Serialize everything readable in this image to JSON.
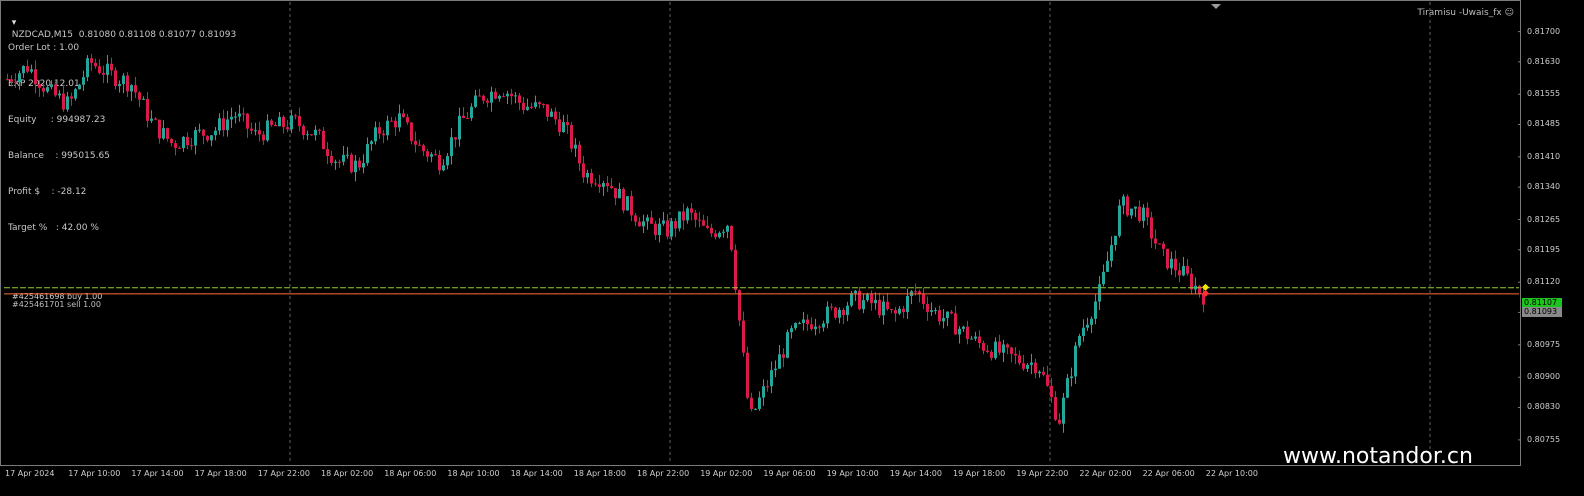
{
  "header": {
    "symbol_line": "NZDCAD,M15  0.81080 0.81108 0.81077 0.81093",
    "ea_name": "Tiramisu -Uwais_fx"
  },
  "info": [
    "Order Lot : 1.00",
    "EXP 2020.12.01",
    "Equity     : 994987.23",
    "Balance    : 995015.65",
    "Profit $    : -28.12",
    "Target %   : 42.00 %"
  ],
  "orders": {
    "buy_label": "#425461698 buy 1.00",
    "sell_label": "#425461701 sell 1.00"
  },
  "price_axis": [
    "0.81700",
    "0.81630",
    "0.81555",
    "0.81485",
    "0.81410",
    "0.81340",
    "0.81265",
    "0.81195",
    "0.81120",
    "0.81050",
    "0.80975",
    "0.80900",
    "0.80830",
    "0.80755"
  ],
  "time_axis": [
    "17 Apr 2024",
    "17 Apr 10:00",
    "17 Apr 14:00",
    "17 Apr 18:00",
    "17 Apr 22:00",
    "18 Apr 02:00",
    "18 Apr 06:00",
    "18 Apr 10:00",
    "18 Apr 14:00",
    "18 Apr 18:00",
    "18 Apr 22:00",
    "19 Apr 02:00",
    "19 Apr 06:00",
    "19 Apr 10:00",
    "19 Apr 14:00",
    "19 Apr 18:00",
    "19 Apr 22:00",
    "22 Apr 02:00",
    "22 Apr 06:00",
    "22 Apr 10:00"
  ],
  "price_tags": {
    "ask": "0.81107",
    "bid": "0.81093"
  },
  "colors": {
    "bull": "#26a69a",
    "bear": "#d81b4a",
    "buy_line": "#9acd32",
    "sell_line": "#ff6a3d",
    "grid": "#7a7a7a"
  },
  "chart_data": {
    "type": "candlestick",
    "symbol": "NZDCAD",
    "timeframe": "M15",
    "ylim": [
      0.8072,
      0.8175
    ],
    "x_categories": [
      "17 Apr 2024",
      "17 Apr 10:00",
      "17 Apr 14:00",
      "17 Apr 18:00",
      "17 Apr 22:00",
      "18 Apr 02:00",
      "18 Apr 06:00",
      "18 Apr 10:00",
      "18 Apr 14:00",
      "18 Apr 18:00",
      "18 Apr 22:00",
      "19 Apr 02:00",
      "19 Apr 06:00",
      "19 Apr 10:00",
      "19 Apr 14:00",
      "19 Apr 18:00",
      "19 Apr 22:00",
      "22 Apr 02:00",
      "22 Apr 06:00",
      "22 Apr 10:00"
    ],
    "close_path": [
      0.8159,
      0.8162,
      0.8156,
      0.8153,
      0.8163,
      0.816,
      0.8158,
      0.8149,
      0.8144,
      0.8146,
      0.8147,
      0.8151,
      0.8146,
      0.8148,
      0.8149,
      0.8146,
      0.814,
      0.8139,
      0.8147,
      0.815,
      0.8143,
      0.814,
      0.8149,
      0.8155,
      0.8157,
      0.8153,
      0.8152,
      0.8148,
      0.8137,
      0.8136,
      0.813,
      0.8125,
      0.8124,
      0.8128,
      0.8123,
      0.8126,
      0.808,
      0.809,
      0.81,
      0.8103,
      0.8105,
      0.8108,
      0.8107,
      0.8104,
      0.811,
      0.8105,
      0.8102,
      0.8098,
      0.8096,
      0.8094,
      0.8093,
      0.808,
      0.81,
      0.811,
      0.813,
      0.8128,
      0.8118,
      0.8114,
      0.8109
    ],
    "orders": [
      {
        "label": "#425461698 buy 1.00",
        "price": 0.81107
      },
      {
        "label": "#425461701 sell 1.00",
        "price": 0.81093
      }
    ]
  }
}
